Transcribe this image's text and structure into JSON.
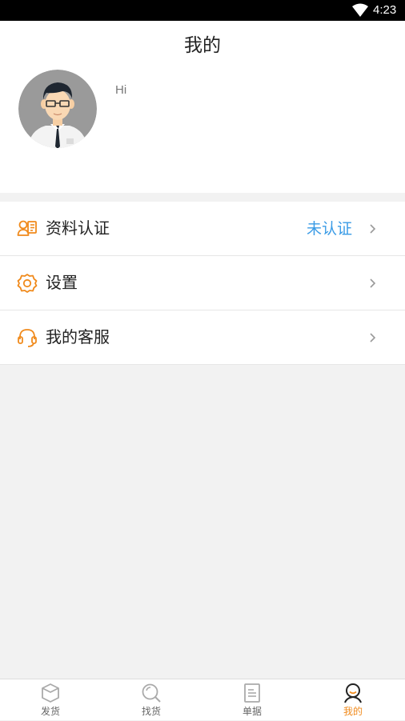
{
  "status_bar": {
    "time": "4:23",
    "icons": [
      "wifi-icon"
    ]
  },
  "header": {
    "title": "我的"
  },
  "profile": {
    "greeting": "Hi",
    "avatar": "user-avatar"
  },
  "menu": {
    "items": [
      {
        "label": "资料认证",
        "status": "未认证",
        "icon": "id-card-icon"
      },
      {
        "label": "设置",
        "icon": "gear-icon"
      },
      {
        "label": "我的客服",
        "icon": "headset-icon"
      }
    ]
  },
  "tabbar": {
    "tabs": [
      {
        "label": "发货",
        "icon": "package-icon",
        "active": false
      },
      {
        "label": "找货",
        "icon": "search-icon",
        "active": false
      },
      {
        "label": "单据",
        "icon": "document-icon",
        "active": false
      },
      {
        "label": "我的",
        "icon": "user-icon",
        "active": true
      }
    ]
  },
  "colors": {
    "accent": "#f08a1c",
    "status_link": "#3a9be6",
    "background": "#f2f2f2",
    "inactive_icon": "#aaaaaa"
  }
}
